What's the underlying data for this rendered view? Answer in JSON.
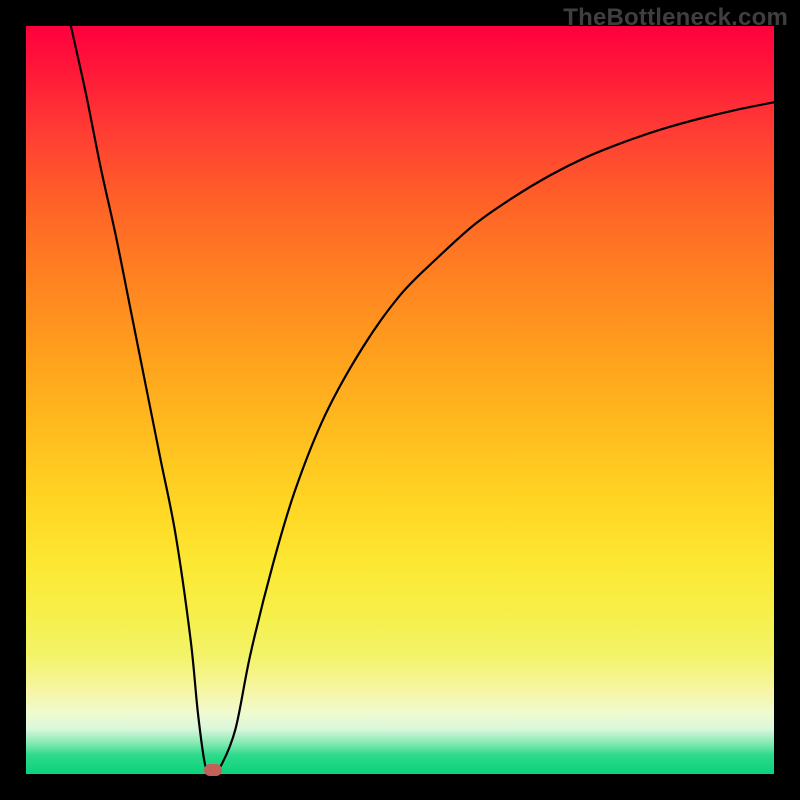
{
  "watermark": "TheBottleneck.com",
  "chart_data": {
    "type": "line",
    "title": "",
    "xlabel": "",
    "ylabel": "",
    "xlim": [
      0,
      100
    ],
    "ylim": [
      0,
      100
    ],
    "grid": false,
    "series": [
      {
        "name": "bottleneck-curve",
        "x": [
          6,
          8,
          10,
          12,
          14,
          16,
          18,
          20,
          22,
          23,
          24,
          25,
          26,
          28,
          30,
          33,
          36,
          40,
          45,
          50,
          55,
          60,
          65,
          70,
          75,
          80,
          85,
          90,
          95,
          100
        ],
        "y": [
          100,
          91,
          81,
          72,
          62,
          52,
          42,
          32,
          18,
          8,
          1,
          0.5,
          1,
          6,
          16,
          28,
          38,
          48,
          57,
          64,
          69,
          73.5,
          77,
          80,
          82.5,
          84.5,
          86.2,
          87.6,
          88.8,
          89.8
        ]
      }
    ],
    "annotations": [
      {
        "name": "min-marker",
        "x": 25,
        "y": 0.5
      }
    ],
    "background_gradient": {
      "top": "#ff003e",
      "mid": "#ffd623",
      "bottom": "#0cd17b"
    }
  }
}
